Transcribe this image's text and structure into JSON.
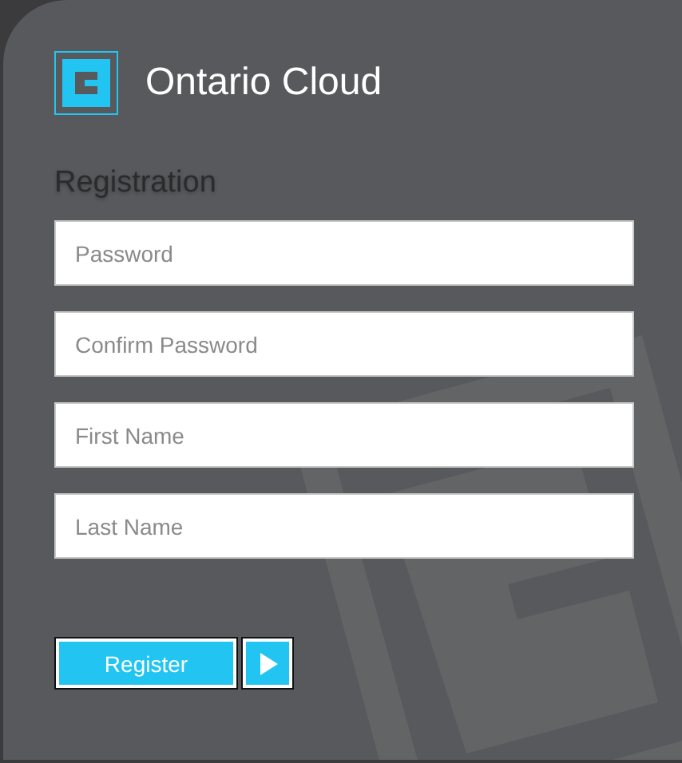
{
  "header": {
    "title": "Ontario Cloud"
  },
  "form": {
    "heading": "Registration",
    "fields": [
      {
        "placeholder": "Password"
      },
      {
        "placeholder": "Confirm Password"
      },
      {
        "placeholder": "First Name"
      },
      {
        "placeholder": "Last Name"
      }
    ],
    "submit": {
      "label": "Register"
    }
  }
}
